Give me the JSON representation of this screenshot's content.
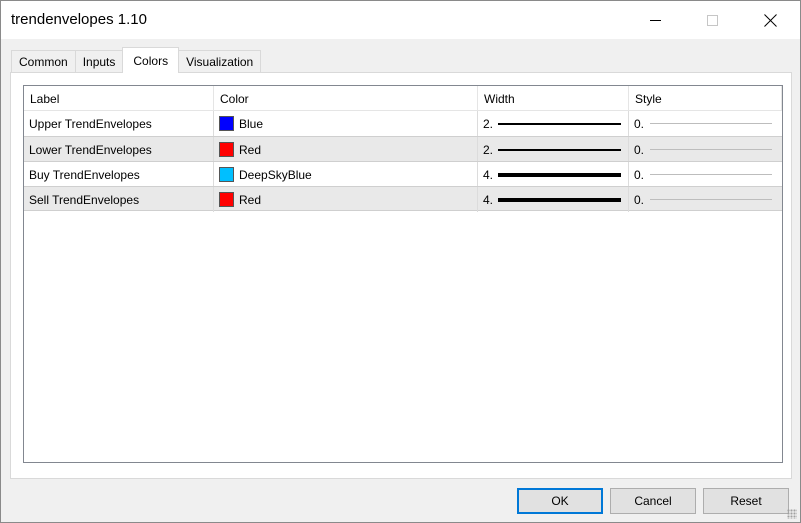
{
  "window": {
    "title": "trendenvelopes 1.10"
  },
  "tabs": [
    {
      "label": "Common"
    },
    {
      "label": "Inputs"
    },
    {
      "label": "Colors"
    },
    {
      "label": "Visualization"
    }
  ],
  "active_tab": "Colors",
  "table": {
    "columns": [
      "Label",
      "Color",
      "Width",
      "Style"
    ],
    "rows": [
      {
        "label": "Upper TrendEnvelopes",
        "color_name": "Blue",
        "color_hex": "#0000ff",
        "width": "2.",
        "style": "0."
      },
      {
        "label": "Lower TrendEnvelopes",
        "color_name": "Red",
        "color_hex": "#ff0000",
        "width": "2.",
        "style": "0."
      },
      {
        "label": "Buy TrendEnvelopes",
        "color_name": "DeepSkyBlue",
        "color_hex": "#00bfff",
        "width": "4.",
        "style": "0."
      },
      {
        "label": "Sell TrendEnvelopes",
        "color_name": "Red",
        "color_hex": "#ff0000",
        "width": "4.",
        "style": "0."
      }
    ]
  },
  "buttons": {
    "ok": "OK",
    "cancel": "Cancel",
    "reset": "Reset"
  },
  "colors": {
    "accent": "#0078d7"
  }
}
